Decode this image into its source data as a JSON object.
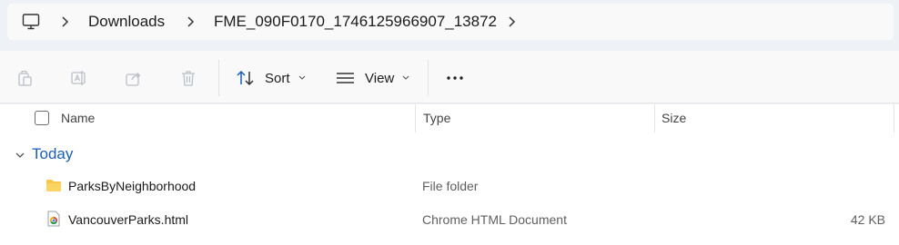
{
  "breadcrumb": {
    "root_icon": "computer-icon",
    "items": [
      "Downloads",
      "FME_090F0170_1746125966907_13872"
    ]
  },
  "toolbar": {
    "sort_label": "Sort",
    "view_label": "View",
    "icons": [
      "copy-icon",
      "rename-icon",
      "share-icon",
      "delete-icon",
      "sort-icon",
      "view-icon",
      "more-icon"
    ]
  },
  "columns": {
    "name": "Name",
    "type": "Type",
    "size": "Size"
  },
  "groups": [
    {
      "label": "Today",
      "items": [
        {
          "name": "ParksByNeighborhood",
          "type": "File folder",
          "size": "",
          "icon": "folder-icon"
        },
        {
          "name": "VancouverParks.html",
          "type": "Chrome HTML Document",
          "size": "42 KB",
          "icon": "chrome-html-icon"
        }
      ]
    }
  ],
  "colors": {
    "accent": "#1a5fb4",
    "folder": "#f8c74a",
    "background": "#eef2f7"
  }
}
